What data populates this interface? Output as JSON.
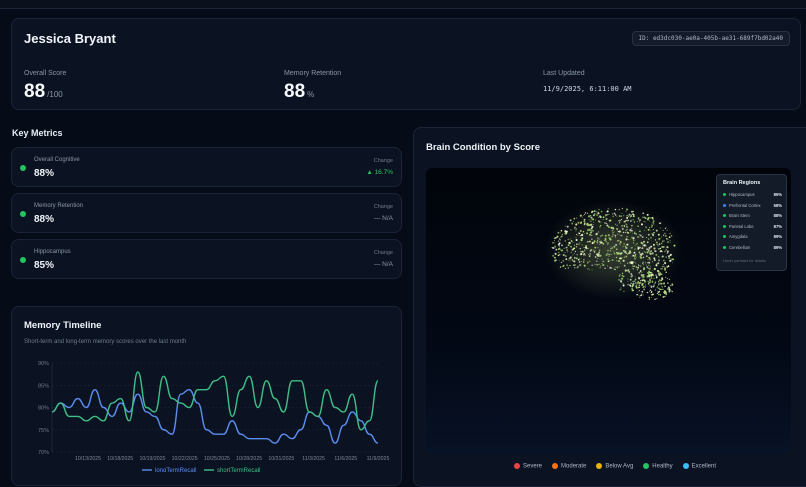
{
  "patient": {
    "name": "Jessica Bryant",
    "id": "ID: ed3dc030-ae0a-405b-ae31-689f7bd02a40"
  },
  "stats": {
    "overall_label": "Overall Score",
    "overall_value": "88",
    "overall_unit": "/100",
    "retention_label": "Memory Retention",
    "retention_value": "88",
    "retention_unit": "%",
    "updated_label": "Last Updated",
    "updated_value": "11/9/2025, 6:11:00 AM"
  },
  "key_metrics": {
    "title": "Key Metrics",
    "items": [
      {
        "label": "Overall Cognitive",
        "value": "88%",
        "change_label": "Change",
        "change_value": "▲ 16.7%"
      },
      {
        "label": "Memory Retention",
        "value": "88%",
        "change_label": "Change",
        "change_value": "— N/A"
      },
      {
        "label": "Hippocampus",
        "value": "85%",
        "change_label": "Change",
        "change_value": "— N/A"
      }
    ]
  },
  "timeline": {
    "title": "Memory Timeline",
    "subtitle": "Short-term and long-term memory scores over the last month"
  },
  "chart_data": {
    "type": "line",
    "title": "Memory Timeline",
    "x": [
      "10/13/2025",
      "10/18/2025",
      "10/19/2025",
      "10/22/2025",
      "10/25/2025",
      "10/28/2025",
      "10/31/2025",
      "11/3/2025",
      "11/6/2025",
      "11/9/2025"
    ],
    "ylim": [
      70,
      90
    ],
    "yticks": [
      "90%",
      "85%",
      "80%",
      "75%",
      "70%"
    ],
    "legend": [
      "longTermRecall",
      "shortTermRecall"
    ],
    "series": [
      {
        "name": "longTermRecall",
        "color": "#5b8def",
        "values": [
          79,
          81,
          80,
          82,
          80,
          84,
          80,
          78,
          81,
          79,
          83,
          79,
          78,
          75,
          74,
          83,
          84,
          81,
          75,
          74,
          74,
          77,
          74,
          73,
          73,
          73,
          72,
          74,
          73,
          75,
          79,
          78,
          76,
          72,
          76,
          79,
          77,
          74,
          72
        ]
      },
      {
        "name": "shortTermRecall",
        "color": "#3fbf86",
        "values": [
          79,
          81,
          78,
          78,
          77,
          78,
          77,
          81,
          82,
          77,
          88,
          80,
          79,
          87,
          82,
          81,
          80,
          84,
          84,
          86,
          87,
          78,
          84,
          87,
          80,
          86,
          82,
          79,
          86,
          86,
          79,
          78,
          84,
          80,
          79,
          83,
          75,
          77,
          86
        ]
      }
    ],
    "grid": true
  },
  "brain": {
    "title": "Brain Condition by Score",
    "panel_title": "Brain Regions",
    "regions": [
      {
        "name": "Hippocampus",
        "score": "85%",
        "color": "#22c55e"
      },
      {
        "name": "Prefrontal Cortex",
        "score": "58%",
        "color": "#3b82f6"
      },
      {
        "name": "Brain Stem",
        "score": "88%",
        "color": "#22c55e"
      },
      {
        "name": "Parietal Lobe",
        "score": "87%",
        "color": "#22c55e"
      },
      {
        "name": "Amygdala",
        "score": "89%",
        "color": "#22c55e"
      },
      {
        "name": "Cerebellum",
        "score": "89%",
        "color": "#22c55e"
      }
    ],
    "hint": "Hover particles for details",
    "legend": [
      {
        "label": "Severe",
        "color": "#ef4444"
      },
      {
        "label": "Moderate",
        "color": "#f97316"
      },
      {
        "label": "Below Avg",
        "color": "#eab308"
      },
      {
        "label": "Healthy",
        "color": "#22c55e"
      },
      {
        "label": "Excellent",
        "color": "#38bdf8"
      }
    ]
  }
}
